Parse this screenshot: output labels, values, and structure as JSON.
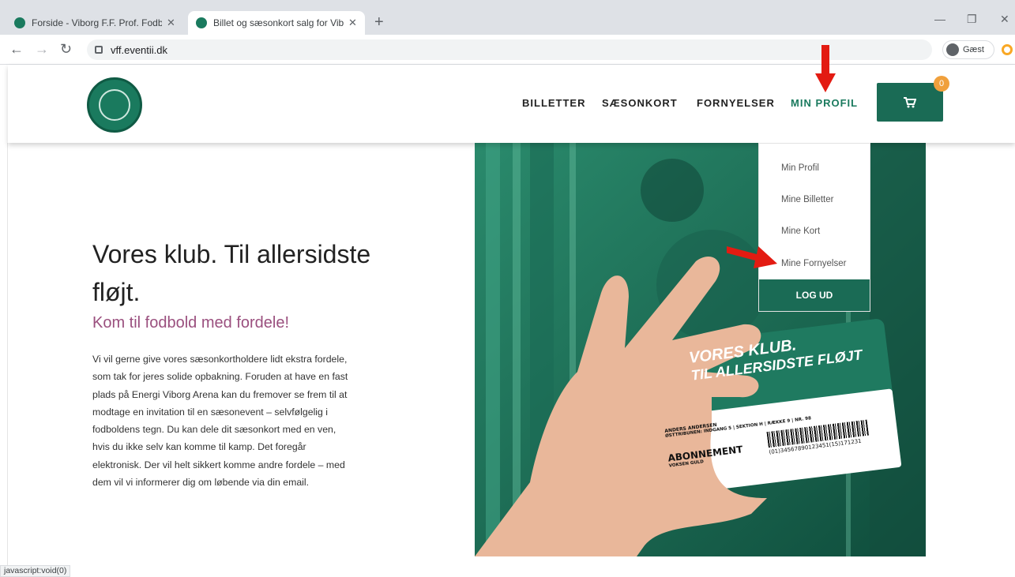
{
  "browser": {
    "tabs": [
      {
        "title": "Forside - Viborg F.F. Prof. Fodbold"
      },
      {
        "title": "Billet og sæsonkort salg for Viborg F.F."
      }
    ],
    "url": "vff.eventii.dk",
    "profile_label": "Gæst"
  },
  "nav": {
    "items": [
      "BILLETTER",
      "SÆSONKORT",
      "FORNYELSER",
      "MIN PROFIL"
    ],
    "cart_count": "0"
  },
  "dropdown": {
    "items": [
      "Min Profil",
      "Mine Billetter",
      "Mine Kort",
      "Mine Fornyelser"
    ],
    "logout": "LOG UD"
  },
  "hero": {
    "title": "Vores klub. Til allersidste fløjt.",
    "subtitle": "Kom til fodbold med fordele!",
    "body": "Vi vil gerne give vores sæsonkortholdere lidt ekstra fordele, som tak for jeres solide opbakning. Foruden at have en fast plads på Energi Viborg Arena kan du fremover se frem til at modtage en invitation til en sæsonevent – selvfølgelig i fodboldens tegn. Du kan dele dit sæsonkort med en ven, hvis du ikke selv kan komme til kamp. Det foregår elektronisk. Der vil helt sikkert komme andre fordele – med dem vil vi informerer dig om løbende via din email."
  },
  "card": {
    "slogan_1": "VORES KLUB.",
    "slogan_2": "TIL ALLERSIDSTE FLØJT",
    "holder": "ANDERS ANDERSEN",
    "seat_line": "ØSTTRIBUNEN: INDGANG 5  |  SEKTION H  |  RÆKKE 9  |  NR. 98",
    "type": "ABONNEMENT",
    "category": "VOKSEN GULD",
    "barcode": "(01)34567890123451(15)171231"
  },
  "status_bar": "javascript:void(0)",
  "colors": {
    "brand": "#1a6b55",
    "accent_text": "#9a4f7e",
    "badge": "#f0a03c",
    "annotation": "#e31b12"
  }
}
